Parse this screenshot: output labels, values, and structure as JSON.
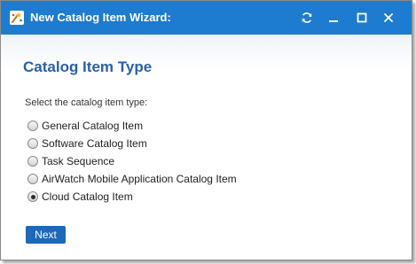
{
  "window": {
    "title": "New Catalog Item Wizard:",
    "title_bar_color": "#1d7bd0",
    "controls": [
      "refresh-icon",
      "minimize-icon",
      "maximize-icon",
      "close-icon"
    ]
  },
  "main": {
    "heading": "Catalog Item Type",
    "instruction": "Select the catalog item type:",
    "options": [
      {
        "label": "General Catalog Item",
        "checked": false
      },
      {
        "label": "Software Catalog Item",
        "checked": false
      },
      {
        "label": "Task Sequence",
        "checked": false
      },
      {
        "label": "AirWatch Mobile Application Catalog Item",
        "checked": false
      },
      {
        "label": "Cloud Catalog Item",
        "checked": true
      }
    ],
    "next_label": "Next",
    "accent_color": "#2b5fa8",
    "button_color": "#1d68b9"
  }
}
